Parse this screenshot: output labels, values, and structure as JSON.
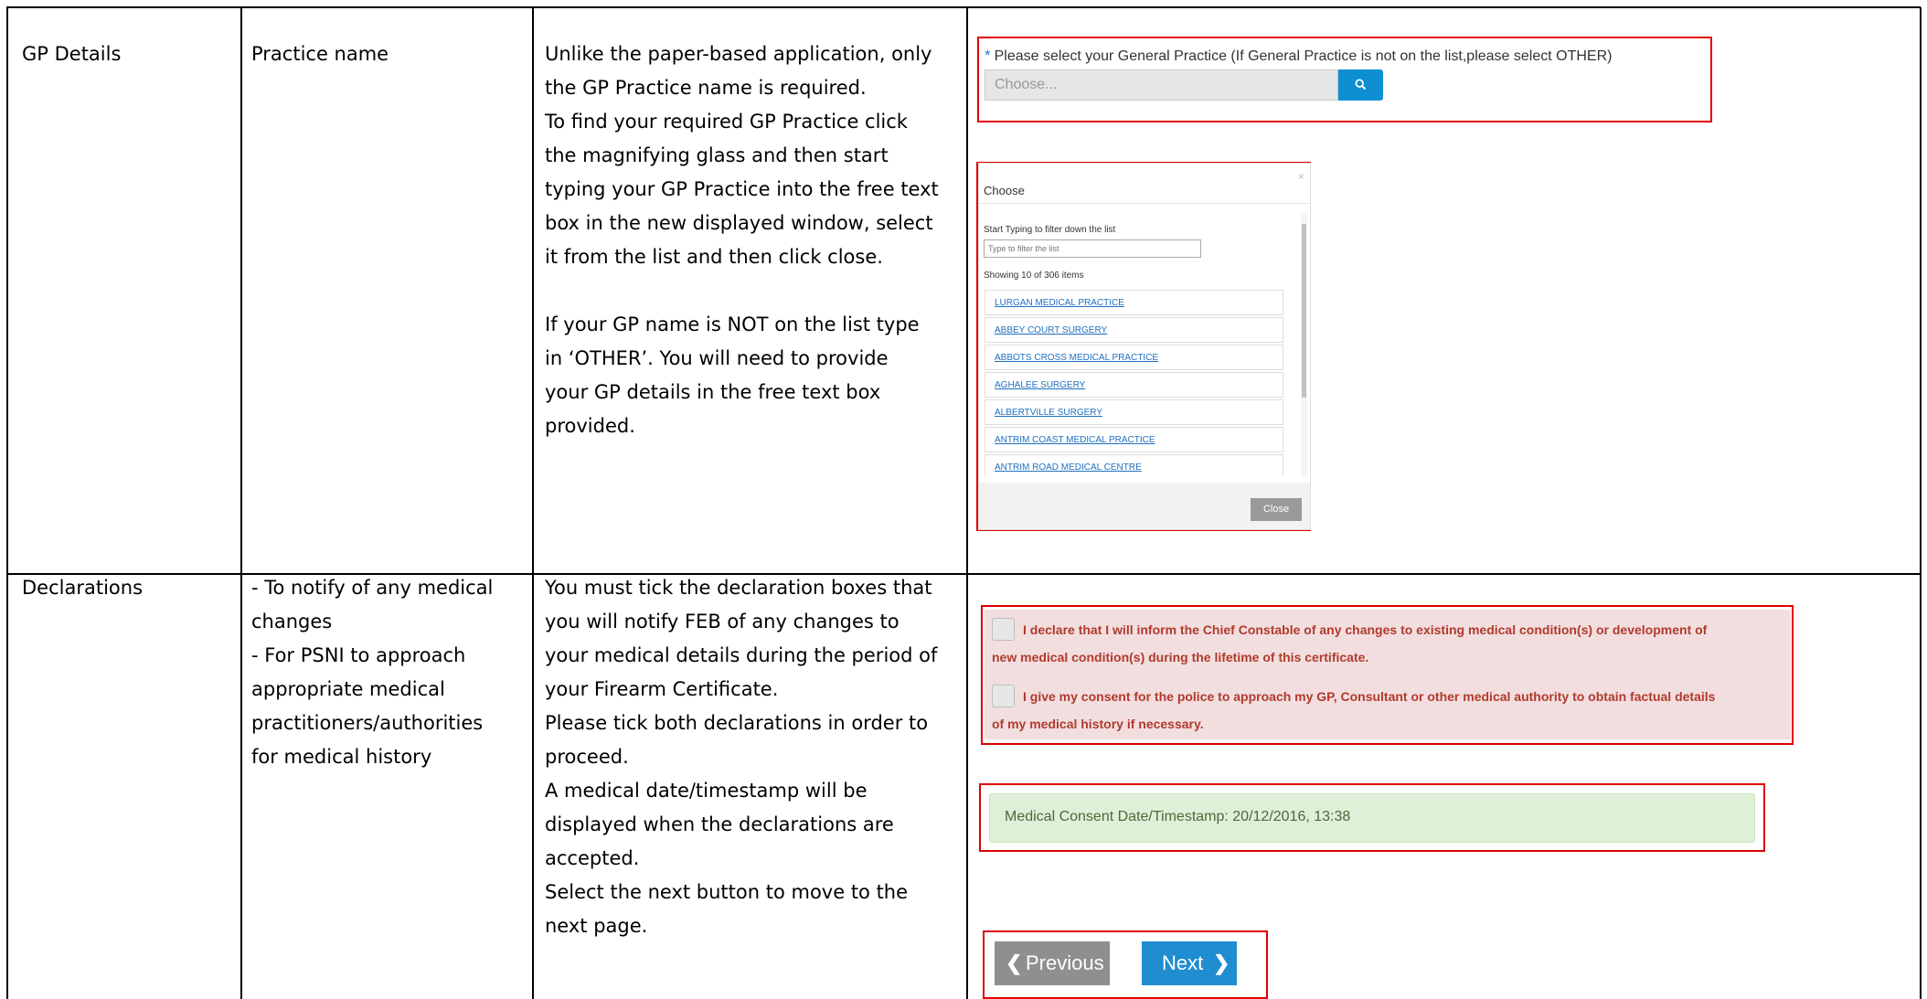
{
  "rows": [
    {
      "section": "GP Details",
      "item": [
        "Practice name"
      ],
      "instructions": [
        "Unlike the paper-based application, only",
        "the GP Practice name is required.",
        "To find your required GP Practice click",
        "the magnifying glass and then start",
        "typing your GP Practice into the free text",
        "box in the new displayed window, select",
        "it from the list and then click close.",
        "",
        "If your GP name is NOT on the list type",
        "in ‘OTHER’. You will need to provide",
        "your GP details in the free text box",
        "provided."
      ]
    },
    {
      "section": "Declarations",
      "item": [
        "- To notify of any medical",
        "changes",
        "- For PSNI to approach",
        "appropriate medical",
        "practitioners/authorities",
        "for medical history"
      ],
      "instructions": [
        "You must tick the declaration boxes that",
        "you will notify FEB of any changes to",
        "your medical details during the period of",
        "your Firearm Certificate.",
        "Please tick both declarations in order to",
        "proceed.",
        "A medical date/timestamp will be",
        "displayed when the declarations are",
        "accepted.",
        "Select the next button to move to the",
        "next page."
      ]
    }
  ],
  "gp_select": {
    "label": "Please select your General Practice (If General Practice is not on the list,please select OTHER)",
    "placeholder": "Choose...",
    "search_icon": "search-icon"
  },
  "modal": {
    "title": "Choose",
    "close_x": "×",
    "filter_label": "Start Typing to filter down the list",
    "filter_placeholder": "Type to filter the list",
    "showing": "Showing 10 of 306 items",
    "items": [
      "LURGAN MEDICAL PRACTICE",
      "ABBEY COURT SURGERY",
      "ABBOTS CROSS MEDICAL PRACTICE",
      "AGHALEE SURGERY",
      "ALBERTVILLE SURGERY",
      "ANTRIM COAST MEDICAL PRACTICE",
      "ANTRIM ROAD MEDICAL CENTRE"
    ],
    "close_label": "Close"
  },
  "declarations": [
    [
      "I declare that I will inform the Chief Constable of any changes to existing medical condition(s) or development of",
      "new medical condition(s) during the lifetime of this certificate."
    ],
    [
      "I give my consent for the police to approach my GP, Consultant or other medical authority to obtain factual details",
      "of my medical history if necessary."
    ]
  ],
  "consent_text": "Medical Consent Date/Timestamp: 20/12/2016, 13:38",
  "nav": {
    "previous": "Previous",
    "next": "Next"
  },
  "colors": {
    "highlight": "#e00000",
    "primary": "#1f8dd0",
    "danger_bg": "#f2dede",
    "success_bg": "#dff0d8"
  }
}
